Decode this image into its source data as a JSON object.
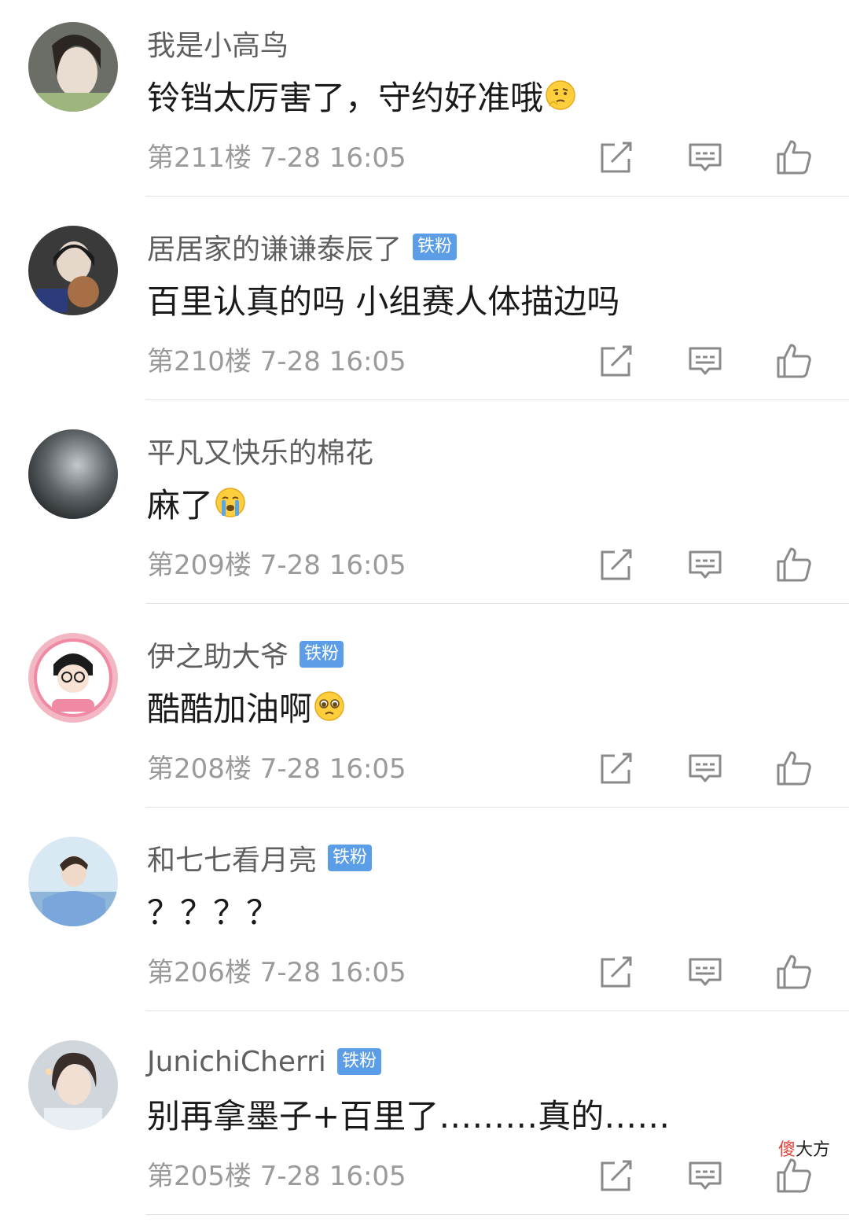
{
  "comments": [
    {
      "username": "我是小高鸟",
      "badge": "",
      "content": "铃铛太厉害了，守约好准哦",
      "emoji": "thinking-emoji",
      "floor": "第211楼",
      "time": "7-28 16:05",
      "avatar_color": "#6b6e66"
    },
    {
      "username": "居居家的谦谦泰辰了",
      "badge": "铁粉",
      "content": "百里认真的吗 小组赛人体描边吗",
      "emoji": "",
      "floor": "第210楼",
      "time": "7-28 16:05",
      "avatar_color": "#3b3a3a"
    },
    {
      "username": "平凡又快乐的棉花",
      "badge": "",
      "content": "麻了",
      "emoji": "crying-emoji",
      "floor": "第209楼",
      "time": "7-28 16:05",
      "avatar_color": "#55595c"
    },
    {
      "username": "伊之助大爷",
      "badge": "铁粉",
      "content": "酷酷加油啊",
      "emoji": "pleading-emoji",
      "floor": "第208楼",
      "time": "7-28 16:05",
      "avatar_color": "#f3b7c4"
    },
    {
      "username": "和七七看月亮",
      "badge": "铁粉",
      "content": "？？？？",
      "emoji": "",
      "floor": "第206楼",
      "time": "7-28 16:05",
      "avatar_color": "#8fb5d9"
    },
    {
      "username": "JunichiCherri",
      "badge": "铁粉",
      "content": "别再拿墨子+百里了………真的……",
      "emoji": "",
      "floor": "第205楼",
      "time": "7-28 16:05",
      "avatar_color": "#b9c3cc"
    }
  ],
  "watermark": {
    "part1": "傻",
    "part2": "大方"
  },
  "colors": {
    "badge": "#5b9de6",
    "meta": "#9a9a9a",
    "username": "#5f5f5f"
  },
  "icons": {
    "share": "share-icon",
    "reply": "reply-icon",
    "like": "thumbs-up-icon"
  }
}
